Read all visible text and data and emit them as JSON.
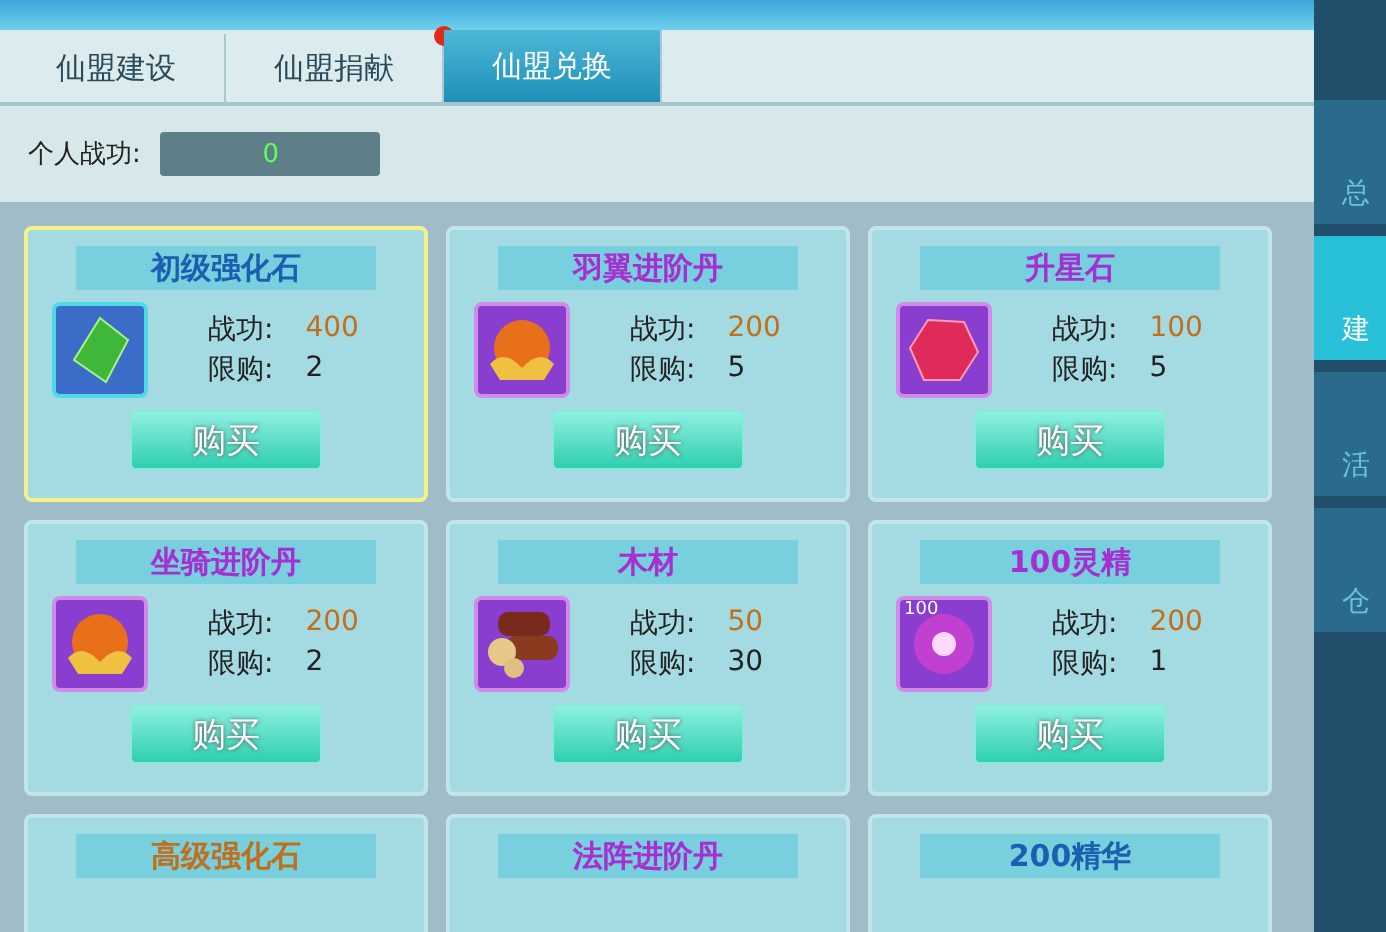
{
  "tabs": [
    {
      "label": "仙盟建设",
      "selected": false,
      "notice": false
    },
    {
      "label": "仙盟捐献",
      "selected": false,
      "notice": true
    },
    {
      "label": "仙盟兑换",
      "selected": true,
      "notice": false
    }
  ],
  "personal": {
    "label": "个人战功:",
    "value": "0"
  },
  "side_tabs": [
    {
      "label": "总",
      "selected": false
    },
    {
      "label": "建",
      "selected": true
    },
    {
      "label": "活",
      "selected": false
    },
    {
      "label": "仓",
      "selected": false
    }
  ],
  "items": [
    {
      "name": "初级强化石",
      "color": "#1a5fb0",
      "kind": "gem",
      "selected": true,
      "cost_label": "战功:",
      "cost": "400",
      "limit_label": "限购:",
      "limit": "2",
      "button": "购买"
    },
    {
      "name": "羽翼进阶丹",
      "color": "#a52fd0",
      "kind": "orb",
      "selected": false,
      "cost_label": "战功:",
      "cost": "200",
      "limit_label": "限购:",
      "limit": "5",
      "button": "购买"
    },
    {
      "name": "升星石",
      "color": "#a52fd0",
      "kind": "ruby",
      "selected": false,
      "cost_label": "战功:",
      "cost": "100",
      "limit_label": "限购:",
      "limit": "5",
      "button": "购买"
    },
    {
      "name": "坐骑进阶丹",
      "color": "#a52fd0",
      "kind": "orb",
      "selected": false,
      "cost_label": "战功:",
      "cost": "200",
      "limit_label": "限购:",
      "limit": "2",
      "button": "购买"
    },
    {
      "name": "木材",
      "color": "#a52fd0",
      "kind": "logs",
      "selected": false,
      "cost_label": "战功:",
      "cost": "50",
      "limit_label": "限购:",
      "limit": "30",
      "button": "购买"
    },
    {
      "name": "100灵精",
      "color": "#a52fd0",
      "kind": "sphere",
      "badge": "100",
      "selected": false,
      "cost_label": "战功:",
      "cost": "200",
      "limit_label": "限购:",
      "limit": "1",
      "button": "购买"
    },
    {
      "name": "高级强化石",
      "color": "#c0701c",
      "selected": false
    },
    {
      "name": "法阵进阶丹",
      "color": "#a52fd0",
      "selected": false
    },
    {
      "name": "200精华",
      "color": "#1a5fb0",
      "selected": false
    }
  ]
}
